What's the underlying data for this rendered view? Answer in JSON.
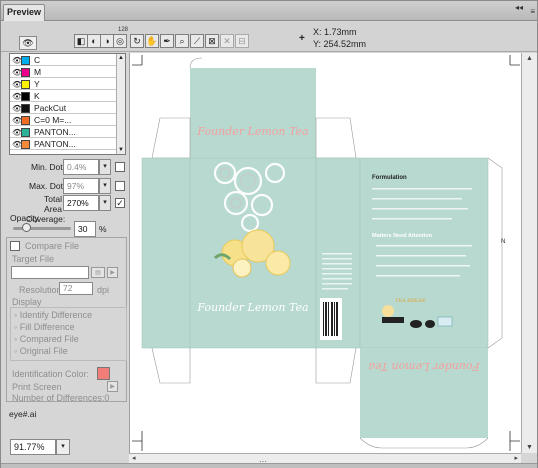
{
  "panel": {
    "tab_label": "Preview",
    "collapse_glyph": "◂◂",
    "menu_glyph": "≡"
  },
  "toolbar": {
    "buttons": [
      {
        "name": "color-mode-icon",
        "glyph": "◧"
      },
      {
        "name": "grayscale-icon",
        "glyph": "◐"
      },
      {
        "name": "separation-icon",
        "glyph": "◑"
      },
      {
        "name": "overprint-icon",
        "glyph": "◎"
      },
      {
        "name": "rotate-icon",
        "glyph": "↻"
      },
      {
        "name": "hand-tool-icon",
        "glyph": "✋"
      },
      {
        "name": "eyedropper-icon",
        "glyph": "✒"
      },
      {
        "name": "zoom-icon",
        "glyph": "⌕"
      },
      {
        "name": "measure-icon",
        "glyph": "⟋"
      },
      {
        "name": "crop-icon",
        "glyph": "⊠"
      },
      {
        "name": "close-icon",
        "glyph": "✕"
      },
      {
        "name": "clear-icon",
        "glyph": "⊟"
      }
    ],
    "mode_badge": "128",
    "eye_glyph": "👁"
  },
  "coords": {
    "x_label": "X:",
    "x_value": "1.73mm",
    "y_label": "Y:",
    "y_value": "254.52mm",
    "cross": "+"
  },
  "plates": [
    {
      "label": "C",
      "color": "#00aeef"
    },
    {
      "label": "M",
      "color": "#ec008c"
    },
    {
      "label": "Y",
      "color": "#fff200"
    },
    {
      "label": "K",
      "color": "#000000"
    },
    {
      "label": "PackCut",
      "color": "#111111"
    },
    {
      "label": "C=0 M=...",
      "color": "#f26c25"
    },
    {
      "label": "PANTON...",
      "color": "#2bb39a"
    },
    {
      "label": "PANTON...",
      "color": "#f58a3b"
    }
  ],
  "dots": {
    "min_label": "Min. Dot:",
    "min_value": "0.4%",
    "max_label": "Max. Dot:",
    "max_value": "97%",
    "tac_label": "Total Area\nCoverage:",
    "tac_line1": "Total Area",
    "tac_line2": "Coverage:",
    "tac_value": "270%"
  },
  "opacity": {
    "label": "Opacity",
    "value": "30",
    "unit": "%",
    "level": 0.3
  },
  "compare": {
    "checkbox_label": "Compare File",
    "target_label": "Target File",
    "resolution_label": "Resolution:",
    "resolution_value": "72",
    "resolution_unit": "dpi",
    "display_label": "Display",
    "display_options": [
      "Identify Difference",
      "Fill Difference",
      "Compared File",
      "Original File"
    ],
    "id_color_label": "Identification Color:",
    "id_color": "#f07d78",
    "print_label": "Print Screen",
    "diff_label": "Number of Differences:0"
  },
  "file_name": "eye#.ai",
  "zoom": {
    "value": "91.77%"
  },
  "artwork": {
    "brand_top": "Founder Lemon Tea",
    "brand_main": "Founder Lemon Tea",
    "brand_rotated": "Founder Lemon Tea",
    "formulation": "Formulation",
    "matters_heading": "Matters Need Attention",
    "side_mark": "N",
    "logo_text": "TEA BREAK"
  }
}
